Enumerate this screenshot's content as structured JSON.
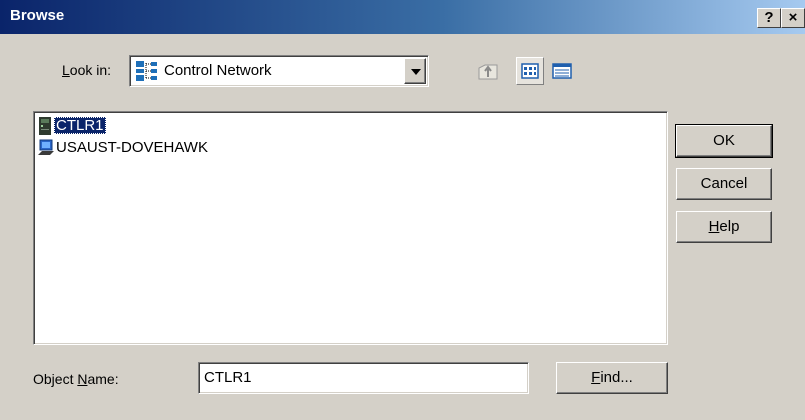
{
  "window": {
    "title": "Browse",
    "help_glyph": "?",
    "close_glyph": "×"
  },
  "lookin": {
    "label_prefix": "",
    "label_u": "L",
    "label_rest": "ook in:",
    "value": "Control Network",
    "icon": "network-tree-icon"
  },
  "toolbar": {
    "icons": [
      "up-one-level-icon",
      "list-view-icon",
      "details-view-icon"
    ]
  },
  "list": {
    "items": [
      {
        "label": "CTLR1",
        "icon": "controller-icon",
        "selected": true
      },
      {
        "label": "USAUST-DOVEHAWK",
        "icon": "computer-icon",
        "selected": false
      }
    ]
  },
  "buttons": {
    "ok": "OK",
    "cancel": "Cancel",
    "help_u": "H",
    "help_rest": "elp"
  },
  "objectname": {
    "label_prefix": "Object ",
    "label_u": "N",
    "label_rest": "ame:",
    "value": "CTLR1"
  },
  "find": {
    "label_u": "F",
    "label_rest": "ind..."
  },
  "colors": {
    "titlebar_start": "#0a246a",
    "titlebar_end": "#a6caf0",
    "dialog_bg": "#d4d0c8",
    "selection": "#0a246a"
  }
}
